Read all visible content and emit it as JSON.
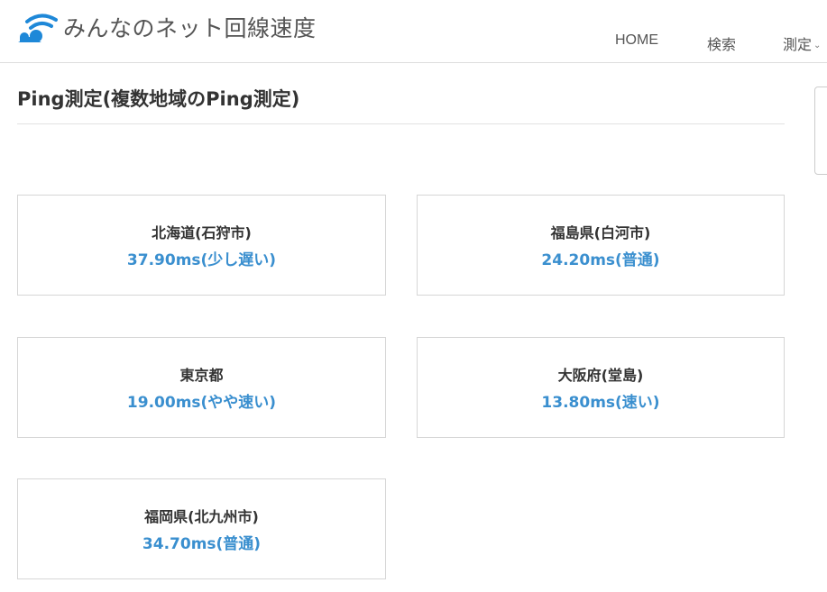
{
  "site": {
    "name": "みんなのネット回線速度",
    "logo_icon": "wifi-signal-icon"
  },
  "nav": {
    "items": [
      {
        "label": "HOME"
      },
      {
        "label": "検索"
      },
      {
        "label": "測定"
      }
    ],
    "dropdown_icon": "chevron-down-icon"
  },
  "page": {
    "title": "Ping測定(複数地域のPing測定)"
  },
  "colors": {
    "result_text": "#3a8fcf",
    "logo_blue": "#1e88d8"
  },
  "results": [
    {
      "region": "北海道(石狩市)",
      "result": "37.90ms(少し遅い)"
    },
    {
      "region": "福島県(白河市)",
      "result": "24.20ms(普通)"
    },
    {
      "region": "東京都",
      "result": "19.00ms(やや速い)"
    },
    {
      "region": "大阪府(堂島)",
      "result": "13.80ms(速い)"
    },
    {
      "region": "福岡県(北九州市)",
      "result": "34.70ms(普通)"
    }
  ]
}
